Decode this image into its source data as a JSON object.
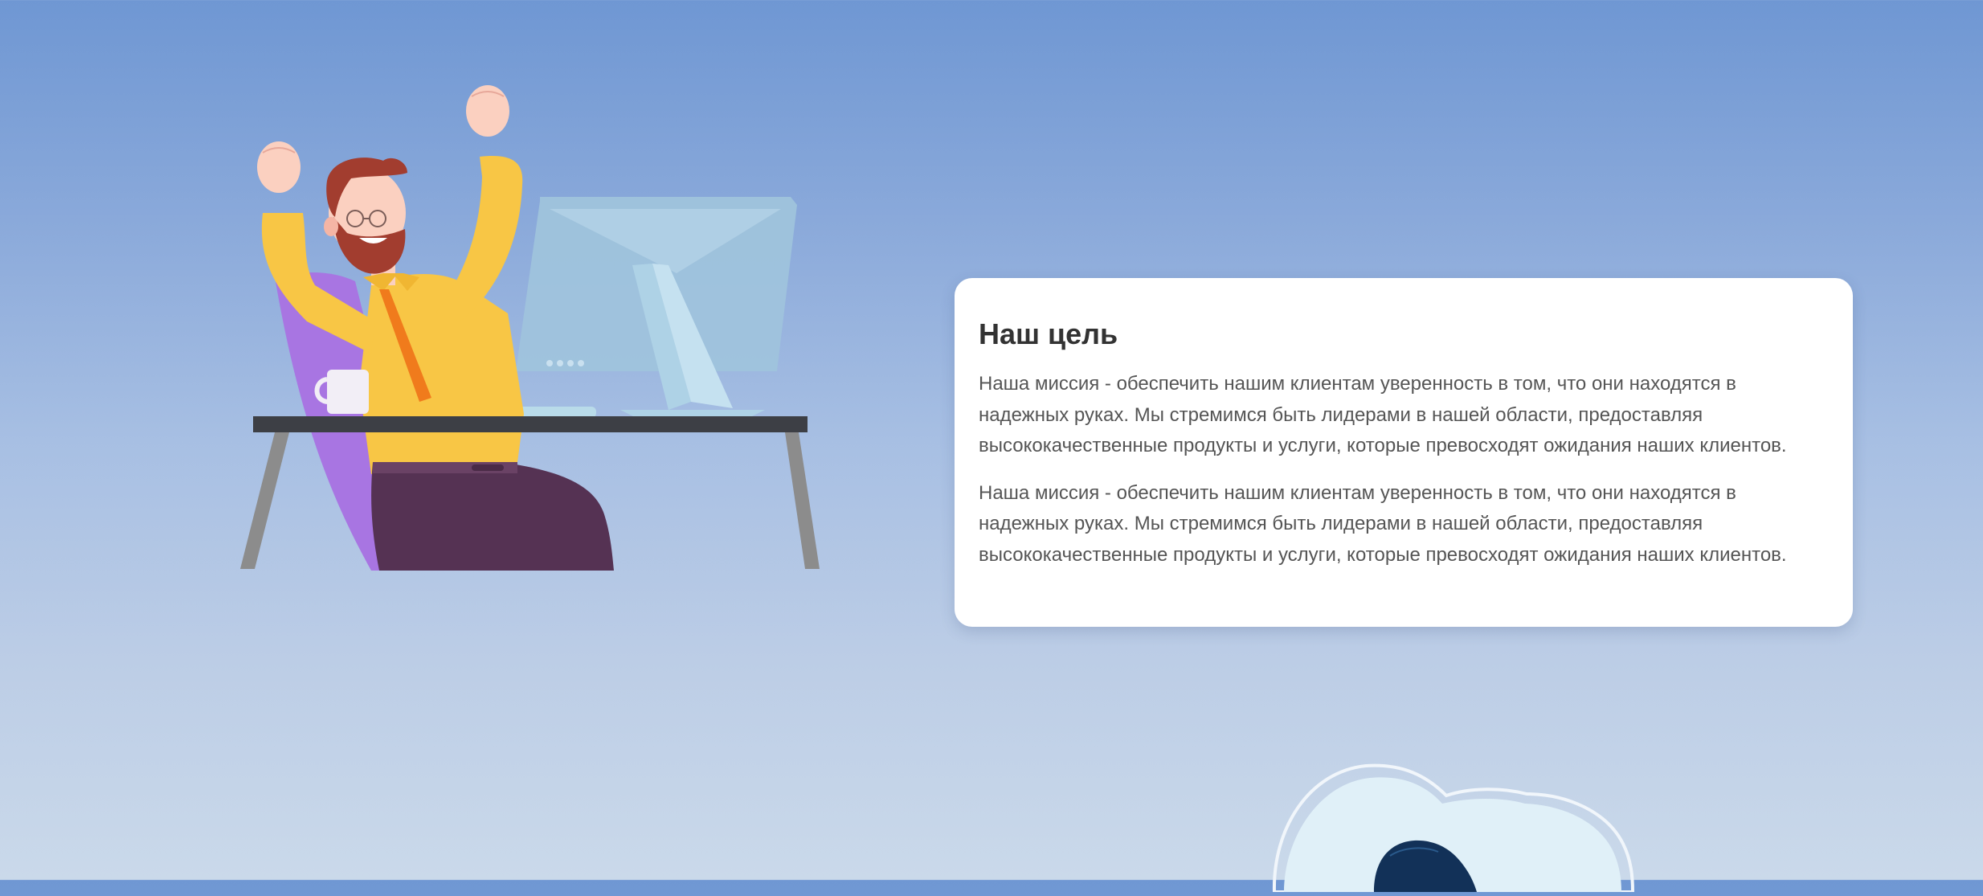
{
  "mission_section": {
    "illustration": {
      "alt": "celebrating-man-at-desk-illustration"
    },
    "card": {
      "title": "Наш цель",
      "paragraphs": [
        "Наша миссия - обеспечить нашим клиентам уверенность в том, что они находятся в надежных руках. Мы стремимся быть лидерами в нашей области, предоставляя высококачественные продукты и услуги, которые превосходят ожидания наших клиентов.",
        "Наша миссия - обеспечить нашим клиентам уверенность в том, что они находятся в надежных руках. Мы стремимся быть лидерами в нашей области, предоставляя высококачественные продукты и услуги, которые превосходят ожидания наших клиентов."
      ]
    }
  },
  "colors": {
    "background_top": "#6f97d3",
    "background_bottom": "#cad9ea",
    "card_bg": "#ffffff",
    "title_color": "#333333",
    "text_color": "#555555",
    "shirt": "#f8c645",
    "pants": "#553253",
    "chair": "#a875e2",
    "monitor": "#9fc3dc",
    "desk_top": "#3d3f45",
    "desk_legs": "#8c8c8c"
  }
}
